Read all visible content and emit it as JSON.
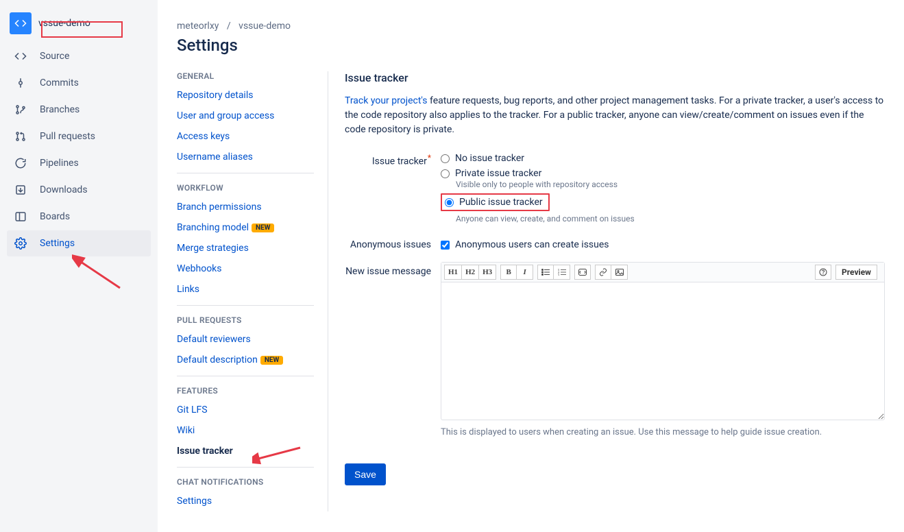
{
  "repo": {
    "name": "vssue-demo",
    "owner": "meteorlxy"
  },
  "breadcrumb": {
    "owner": "meteorlxy",
    "repo": "vssue-demo"
  },
  "page_title": "Settings",
  "left_nav": [
    {
      "icon": "code",
      "label": "Source"
    },
    {
      "icon": "commit",
      "label": "Commits"
    },
    {
      "icon": "branch",
      "label": "Branches"
    },
    {
      "icon": "pr",
      "label": "Pull requests"
    },
    {
      "icon": "pipeline",
      "label": "Pipelines"
    },
    {
      "icon": "download",
      "label": "Downloads"
    },
    {
      "icon": "board",
      "label": "Boards"
    },
    {
      "icon": "gear",
      "label": "Settings",
      "selected": true
    }
  ],
  "submenu": {
    "general": {
      "head": "GENERAL",
      "items": [
        {
          "label": "Repository details"
        },
        {
          "label": "User and group access"
        },
        {
          "label": "Access keys"
        },
        {
          "label": "Username aliases"
        }
      ]
    },
    "workflow": {
      "head": "WORKFLOW",
      "items": [
        {
          "label": "Branch permissions"
        },
        {
          "label": "Branching model",
          "new": true
        },
        {
          "label": "Merge strategies"
        },
        {
          "label": "Webhooks"
        },
        {
          "label": "Links"
        }
      ]
    },
    "pull_requests": {
      "head": "PULL REQUESTS",
      "items": [
        {
          "label": "Default reviewers"
        },
        {
          "label": "Default description",
          "new": true
        }
      ]
    },
    "features": {
      "head": "FEATURES",
      "items": [
        {
          "label": "Git LFS"
        },
        {
          "label": "Wiki"
        },
        {
          "label": "Issue tracker",
          "active": true
        }
      ]
    },
    "chat": {
      "head": "CHAT NOTIFICATIONS",
      "items": [
        {
          "label": "Settings"
        }
      ]
    },
    "new_badge": "NEW"
  },
  "pane": {
    "title": "Issue tracker",
    "desc_link": "Track your project's",
    "desc_rest": " feature requests, bug reports, and other project management tasks. For a private tracker, a user's access to the code repository also applies to the tracker. For a public tracker, anyone can view/create/comment on issues even if the code repository is private.",
    "labels": {
      "issue_tracker": "Issue tracker",
      "anonymous": "Anonymous issues",
      "new_issue_msg": "New issue message"
    },
    "radios": {
      "none": "No issue tracker",
      "private": "Private issue tracker",
      "private_sub": "Visible only to people with repository access",
      "public": "Public issue tracker",
      "public_sub": "Anyone can view, create, and comment on issues"
    },
    "anon_checkbox": "Anonymous users can create issues",
    "toolbar": {
      "h1": "H1",
      "h2": "H2",
      "h3": "H3",
      "bold": "B",
      "italic": "I",
      "preview": "Preview"
    },
    "help_text": "This is displayed to users when creating an issue. Use this message to help guide issue creation.",
    "save": "Save"
  }
}
